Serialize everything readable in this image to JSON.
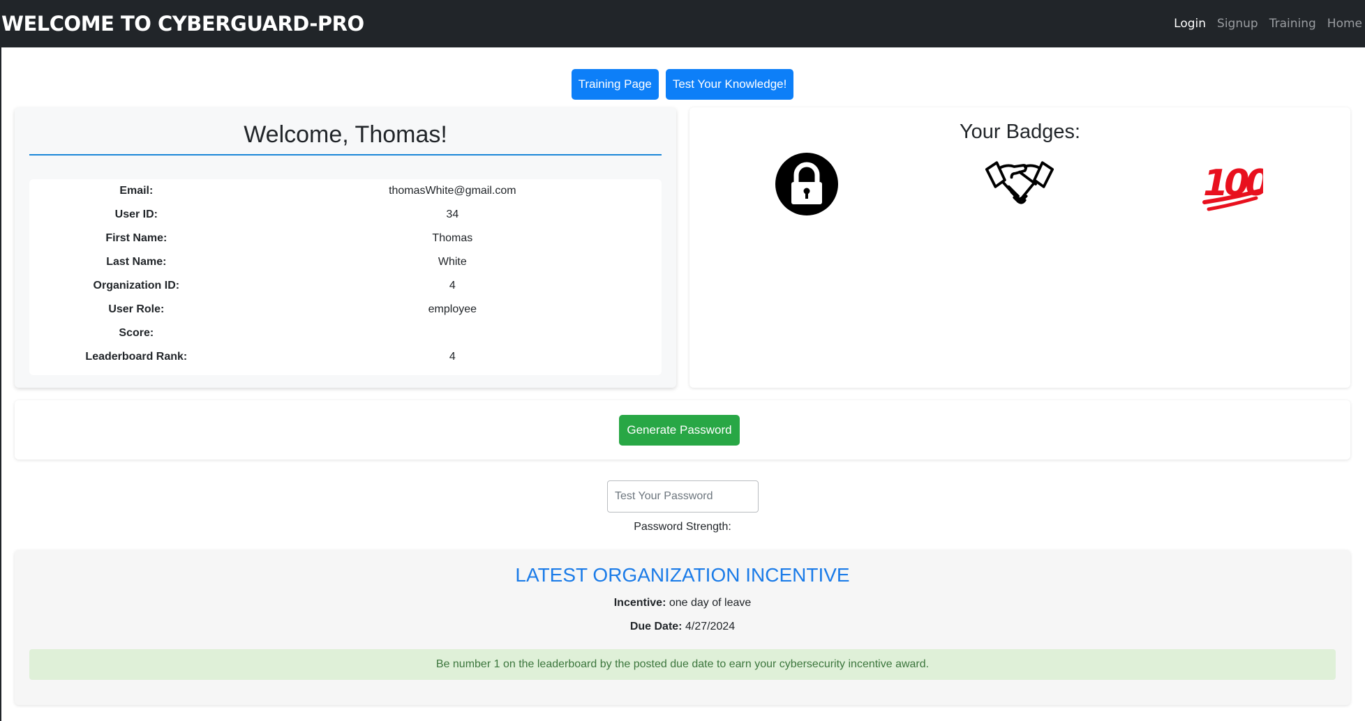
{
  "navbar": {
    "brand": "WELCOME TO CYBERGUARD-PRO",
    "links": [
      "Login",
      "Signup",
      "Training",
      "Home"
    ]
  },
  "top_buttons": {
    "training": "Training Page",
    "quiz": "Test Your Knowledge!"
  },
  "welcome": {
    "title": "Welcome, Thomas!",
    "fields": [
      {
        "label": "Email:",
        "value": "thomasWhite@gmail.com"
      },
      {
        "label": "User ID:",
        "value": "34"
      },
      {
        "label": "First Name:",
        "value": "Thomas"
      },
      {
        "label": "Last Name:",
        "value": "White"
      },
      {
        "label": "Organization ID:",
        "value": "4"
      },
      {
        "label": "User Role:",
        "value": "employee"
      },
      {
        "label": "Score:",
        "value": ""
      },
      {
        "label": "Leaderboard Rank:",
        "value": "4"
      }
    ]
  },
  "badges": {
    "title": "Your Badges:",
    "items": [
      "lock-icon",
      "handshake-icon",
      "hundred-points-icon"
    ],
    "hundred_color": "#e8101e"
  },
  "generate": {
    "button": "Generate Password"
  },
  "password_test": {
    "placeholder": "Test Your Password",
    "strength_label": "Password Strength:"
  },
  "incentive": {
    "title": "LATEST ORGANIZATION INCENTIVE",
    "incentive_label": "Incentive:",
    "incentive_value": "one day of leave",
    "due_label": "Due Date:",
    "due_value": "4/27/2024",
    "alert": "Be number 1 on the leaderboard by the posted due date to earn your cybersecurity incentive award."
  },
  "colors": {
    "navbar": "#212529",
    "primary": "#0d7ff8",
    "success": "#28a745",
    "incentive_title": "#1a7be8",
    "alert_bg": "#dff0d8",
    "alert_text": "#3c763d"
  }
}
